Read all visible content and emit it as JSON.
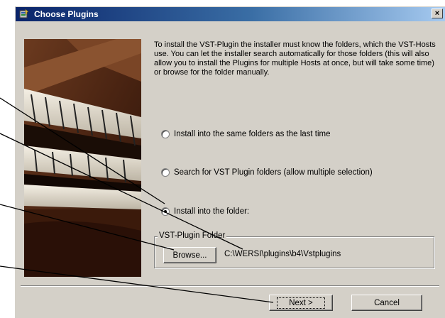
{
  "window": {
    "title": "Choose Plugins",
    "close_glyph": "×"
  },
  "intro_text": "To install the VST-Plugin the installer must know the folders, which the VST-Hosts use. You can let the installer search automatically for those folders (this will also allow you to install the Plugins for multiple Hosts at once, but will take some time) or browse for the folder manually.",
  "options": [
    {
      "label": "Install into the same folders as the last time",
      "checked": false
    },
    {
      "label": "Search for VST Plugin folders (allow multiple selection)",
      "checked": false
    },
    {
      "label": "Install into the folder:",
      "checked": true
    }
  ],
  "folder_group": {
    "legend": "VST-Plugin Folder",
    "browse_label": "Browse...",
    "path": "C:\\WERSI\\plugins\\b4\\Vstplugins"
  },
  "buttons": {
    "next_label": "Next >",
    "cancel_label": "Cancel"
  },
  "icons": [
    "installer-icon",
    "close-icon"
  ],
  "colors": {
    "titlebar_start": "#0a246a",
    "titlebar_end": "#a6caf0",
    "dialog_bg": "#d4d0c8"
  }
}
